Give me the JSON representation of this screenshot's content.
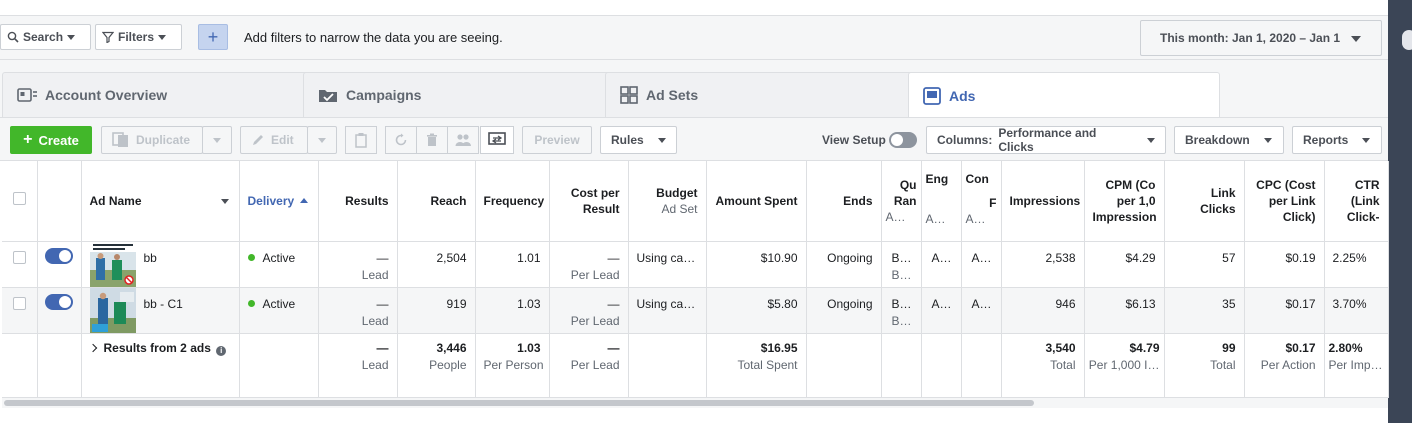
{
  "filter_bar": {
    "search_label": "Search",
    "filters_label": "Filters",
    "plus_label": "+",
    "hint": "Add filters to narrow the data you are seeing.",
    "date_range": "This month: Jan 1, 2020 – Jan 1"
  },
  "tabs": [
    {
      "label": "Account Overview",
      "icon": "account-overview-icon"
    },
    {
      "label": "Campaigns",
      "icon": "campaigns-icon"
    },
    {
      "label": "Ad Sets",
      "icon": "ad-sets-icon"
    },
    {
      "label": "Ads",
      "icon": "ads-icon"
    }
  ],
  "toolbar": {
    "create_label": "Create",
    "duplicate_label": "Duplicate",
    "edit_label": "Edit",
    "preview_label": "Preview",
    "rules_label": "Rules",
    "view_setup_label": "View Setup",
    "columns_prefix": "Columns:",
    "columns_value": "Performance and Clicks",
    "breakdown_label": "Breakdown",
    "reports_label": "Reports"
  },
  "table": {
    "headers": {
      "ad_name": "Ad Name",
      "delivery": "Delivery",
      "results": "Results",
      "reach": "Reach",
      "frequency": "Frequency",
      "cost_per_result": "Cost per Result",
      "budget": "Budget",
      "budget_sub": "Ad Set",
      "amount_spent": "Amount Spent",
      "ends": "Ends",
      "quality": "Qu Ran",
      "quality_sub": "A…",
      "engagement": "Eng",
      "engagement_sub": "A…",
      "conversion": "Con",
      "conversion_sub_1": "F",
      "conversion_sub_2": "A…",
      "impressions": "Impressions",
      "cpm": "CPM (Co per 1,0 Impression",
      "link_clicks": "Link Clicks",
      "cpc": "CPC (Cost per Link Click)",
      "ctr": "CTR (Link Click-"
    },
    "rows": [
      {
        "name": "bb",
        "delivery": "Active",
        "results": "—",
        "results_sub": "Lead",
        "reach": "2,504",
        "frequency": "1.01",
        "cost_per_result": "—",
        "cost_per_result_sub": "Per Lead",
        "budget": "Using ca…",
        "amount_spent": "$10.90",
        "ends": "Ongoing",
        "quality": "B…",
        "quality_sub": "B…",
        "engagement": "A…",
        "conversion": "A…",
        "impressions": "2,538",
        "cpm": "$4.29",
        "link_clicks": "57",
        "cpc": "$0.19",
        "ctr": "2.25%"
      },
      {
        "name": "bb - C1",
        "delivery": "Active",
        "results": "—",
        "results_sub": "Lead",
        "reach": "919",
        "frequency": "1.03",
        "cost_per_result": "—",
        "cost_per_result_sub": "Per Lead",
        "budget": "Using ca…",
        "amount_spent": "$5.80",
        "ends": "Ongoing",
        "quality": "B…",
        "quality_sub": "B…",
        "engagement": "A…",
        "conversion": "A…",
        "impressions": "946",
        "cpm": "$6.13",
        "link_clicks": "35",
        "cpc": "$0.17",
        "ctr": "3.70%"
      }
    ],
    "totals": {
      "label": "Results from 2 ads",
      "results": "—",
      "results_sub": "Lead",
      "reach": "3,446",
      "reach_sub": "People",
      "frequency": "1.03",
      "frequency_sub": "Per Person",
      "cost_per_result": "—",
      "cost_per_result_sub": "Per Lead",
      "amount_spent": "$16.95",
      "amount_spent_sub": "Total Spent",
      "impressions": "3,540",
      "impressions_sub": "Total",
      "cpm": "$4.79",
      "cpm_sub": "Per 1,000 I…",
      "link_clicks": "99",
      "link_clicks_sub": "Total",
      "cpc": "$0.17",
      "cpc_sub": "Per Action",
      "ctr": "2.80%",
      "ctr_sub": "Per Imp…"
    }
  }
}
